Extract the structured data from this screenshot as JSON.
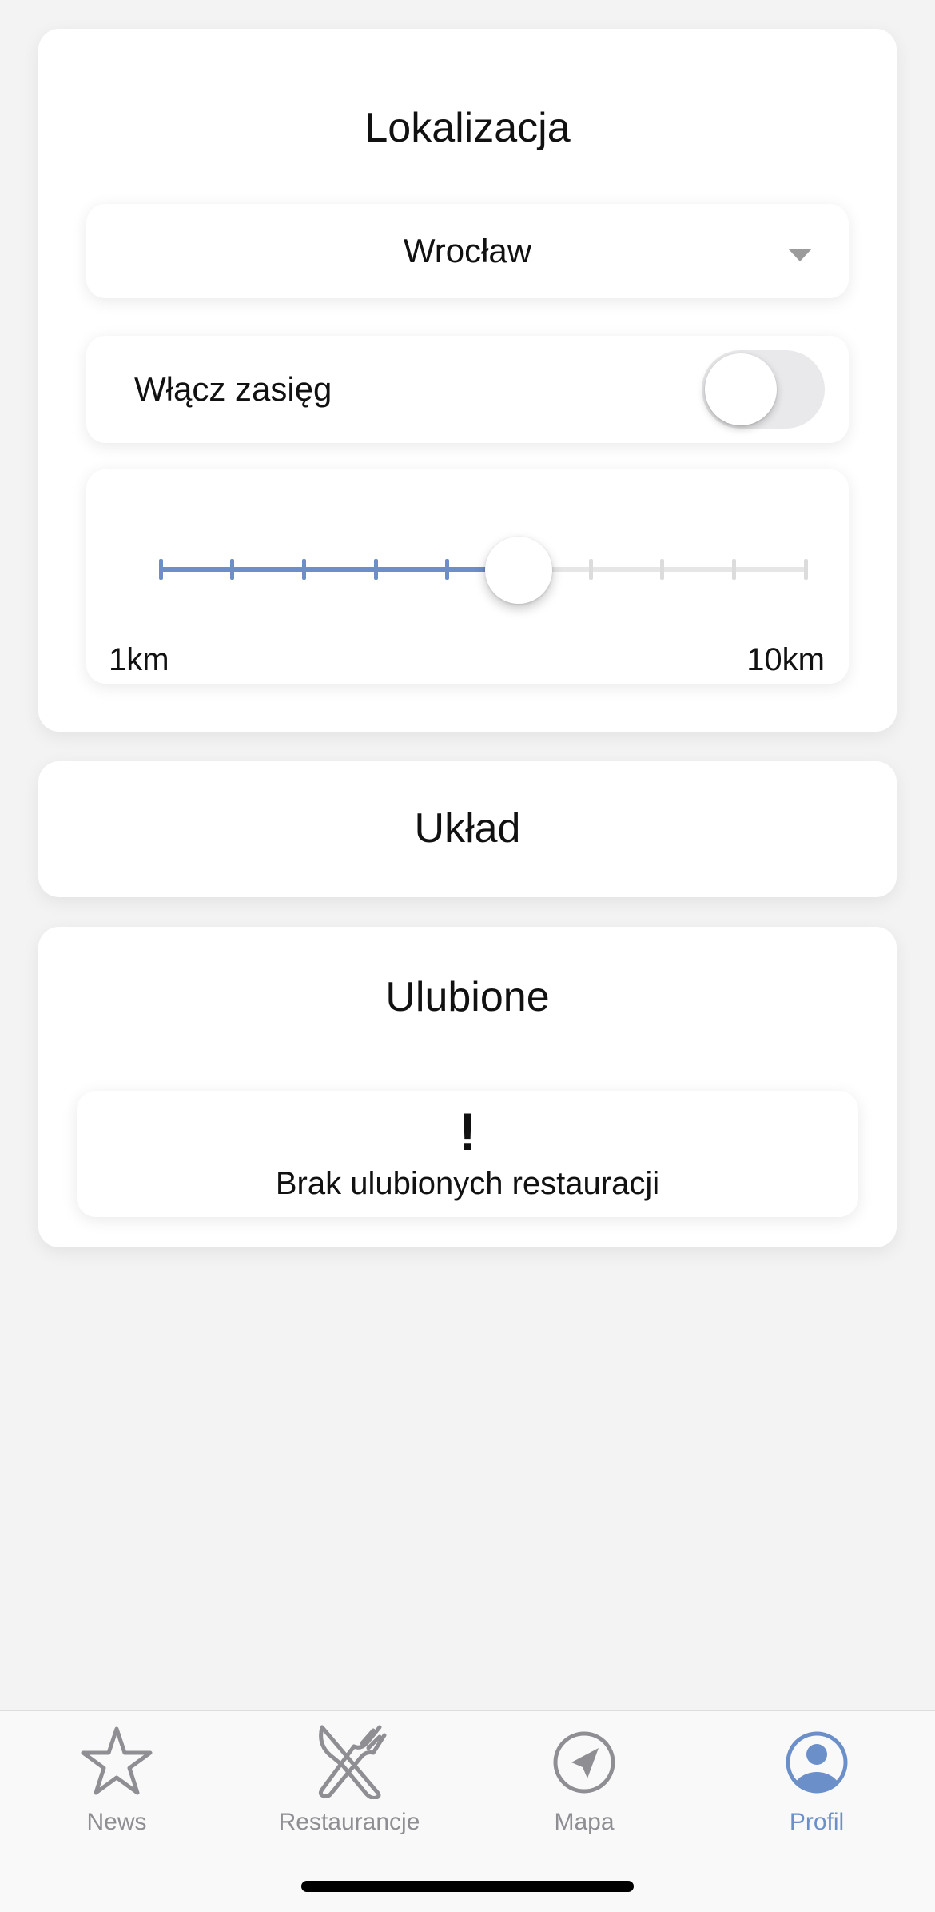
{
  "location_card": {
    "title": "Lokalizacja",
    "city_dropdown": {
      "selected": "Wrocław"
    },
    "range_toggle": {
      "label": "Włącz zasięg",
      "enabled": false
    },
    "range_slider": {
      "min_label": "1km",
      "max_label": "10km",
      "min_km": 1,
      "max_km": 10,
      "value_km": 6,
      "steps": 10
    }
  },
  "layout_card": {
    "title": "Układ"
  },
  "favorites_card": {
    "title": "Ulubione",
    "empty_state": {
      "icon": "!",
      "message": "Brak ulubionych restauracji"
    }
  },
  "tabbar": {
    "tabs": [
      {
        "label": "News",
        "icon": "star-icon",
        "active": false
      },
      {
        "label": "Restaurancje",
        "icon": "fork-knife-icon",
        "active": false
      },
      {
        "label": "Mapa",
        "icon": "navigation-arrow-icon",
        "active": false
      },
      {
        "label": "Profil",
        "icon": "profile-icon",
        "active": true
      }
    ]
  },
  "colors": {
    "accent": "#6b8fc9",
    "inactive": "#8e8e93",
    "background": "#f3f3f3"
  }
}
